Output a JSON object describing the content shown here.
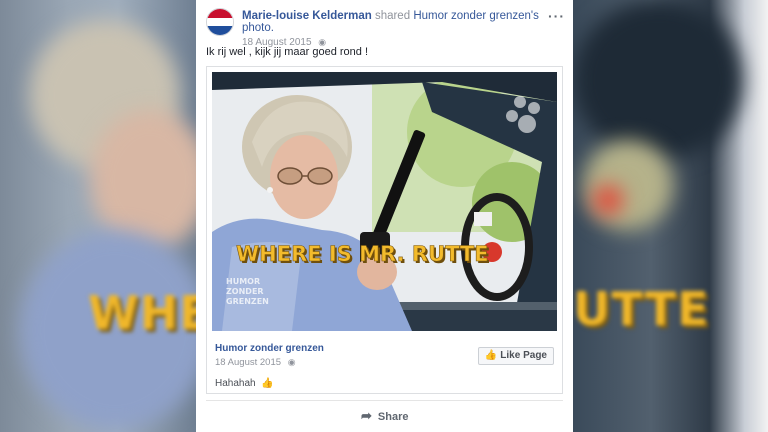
{
  "post": {
    "author": "Marie-louise Kelderman",
    "shared_label": "shared",
    "shared_page": "Humor zonder grenzen's photo.",
    "date": "18 August 2015",
    "caption": "Ik rij wel , kijk jij maar goed rond !",
    "more_icon": "more-options-icon",
    "globe_icon": "globe-icon"
  },
  "photo": {
    "banner_text": "WHERE IS MR. RUTTE",
    "watermark": [
      "HUMOR",
      "ZONDER",
      "GRENZEN"
    ],
    "background_banner": "WHE",
    "background_banner_right": "UTTE"
  },
  "shared": {
    "page_name": "Humor zonder grenzen",
    "date": "18 August 2015",
    "text": "Hahahah",
    "like_button": "Like Page",
    "like_icon": "thumbs-up-icon"
  },
  "actions": {
    "share_label": "Share",
    "share_icon": "share-arrow-icon"
  },
  "colors": {
    "link": "#365899",
    "meta": "#90949c",
    "banner": "#f0b72a"
  }
}
